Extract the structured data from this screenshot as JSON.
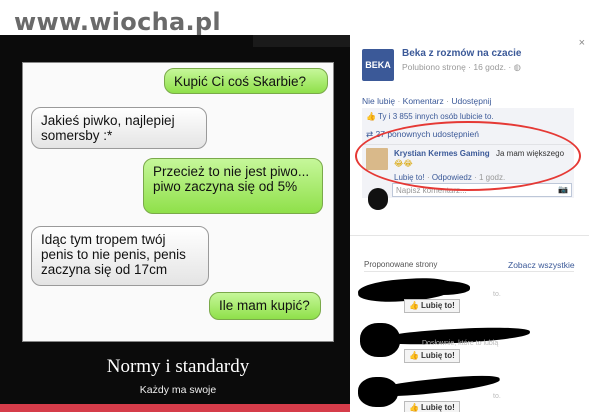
{
  "watermark": {
    "text": "www.wiocha.pl"
  },
  "meme": {
    "bubbles": [
      "Kupić Ci coś Skarbie?",
      "Jakieś piwko, najlepiej somersby :*",
      "Przecież to nie jest piwo... piwo zaczyna się od 5%",
      "Idąc tym tropem twój penis to nie penis, penis zaczyna się od 17cm",
      "Ile mam kupić?"
    ],
    "title": "Normy i standardy",
    "subtitle": "Każdy ma swoje"
  },
  "fb": {
    "close": "×",
    "page": {
      "name": "Beka z rozmów na czacie",
      "meta": "Polubiono stronę · 16 godz. ·",
      "avatar_text": "BEKA"
    },
    "actions": [
      "Nie lubię",
      "Komentarz",
      "Udostępnij"
    ],
    "likes_text": "Ty i 3 855 innych osób lubicie to.",
    "shares_text": "27 ponownych udostępnień",
    "comment": {
      "author": "Krystian Kermes Gaming",
      "text": "Ja mam większego",
      "emoji": "😂😂",
      "like_label": "Lubię to!",
      "reply_label": "Odpowiedz",
      "time": "1 godz."
    },
    "comment_placeholder": "Napisz komentarz...",
    "suggested": {
      "title": "Proponowane strony",
      "see_all": "Zobacz wszystkie",
      "like_button": "Lubię to!",
      "faint_texts": [
        "to.",
        "Dosłownie, które to lubią",
        "to."
      ]
    }
  }
}
